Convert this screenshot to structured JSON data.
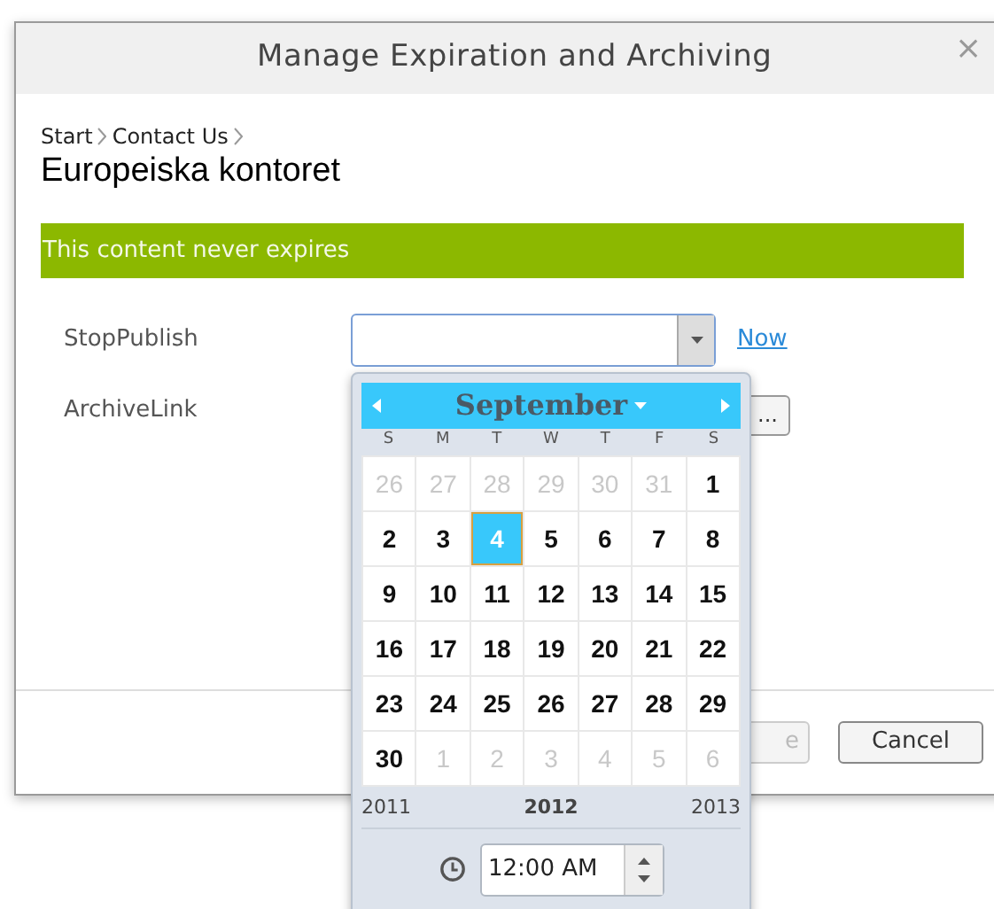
{
  "dialog": {
    "title": "Manage Expiration and Archiving",
    "close": "×"
  },
  "breadcrumb": [
    "Start",
    "Contact Us"
  ],
  "heading": "Europeiska kontoret",
  "notice": "This content never expires",
  "fields": [
    {
      "kind": "date",
      "label": "StopPublish",
      "link": "Now"
    },
    {
      "kind": "browse",
      "label": "ArchiveLink",
      "button": "..."
    }
  ],
  "footer_buttons": [
    {
      "label": "e",
      "covered": true
    },
    {
      "label": "Cancel",
      "covered": false
    }
  ],
  "calendar": {
    "month": "September",
    "prev_year": "2011",
    "year": "2012",
    "next_year": "2013",
    "weekdays": [
      "S",
      "M",
      "T",
      "W",
      "T",
      "F",
      "S"
    ],
    "days": [
      {
        "label": "26",
        "other_month": true,
        "selected": false
      },
      {
        "label": "27",
        "other_month": true,
        "selected": false
      },
      {
        "label": "28",
        "other_month": true,
        "selected": false
      },
      {
        "label": "29",
        "other_month": true,
        "selected": false
      },
      {
        "label": "30",
        "other_month": true,
        "selected": false
      },
      {
        "label": "31",
        "other_month": true,
        "selected": false
      },
      {
        "label": "1",
        "other_month": false,
        "selected": false
      },
      {
        "label": "2",
        "other_month": false,
        "selected": false
      },
      {
        "label": "3",
        "other_month": false,
        "selected": false
      },
      {
        "label": "4",
        "other_month": false,
        "selected": true
      },
      {
        "label": "5",
        "other_month": false,
        "selected": false
      },
      {
        "label": "6",
        "other_month": false,
        "selected": false
      },
      {
        "label": "7",
        "other_month": false,
        "selected": false
      },
      {
        "label": "8",
        "other_month": false,
        "selected": false
      },
      {
        "label": "9",
        "other_month": false,
        "selected": false
      },
      {
        "label": "10",
        "other_month": false,
        "selected": false
      },
      {
        "label": "11",
        "other_month": false,
        "selected": false
      },
      {
        "label": "12",
        "other_month": false,
        "selected": false
      },
      {
        "label": "13",
        "other_month": false,
        "selected": false
      },
      {
        "label": "14",
        "other_month": false,
        "selected": false
      },
      {
        "label": "15",
        "other_month": false,
        "selected": false
      },
      {
        "label": "16",
        "other_month": false,
        "selected": false
      },
      {
        "label": "17",
        "other_month": false,
        "selected": false
      },
      {
        "label": "18",
        "other_month": false,
        "selected": false
      },
      {
        "label": "19",
        "other_month": false,
        "selected": false
      },
      {
        "label": "20",
        "other_month": false,
        "selected": false
      },
      {
        "label": "21",
        "other_month": false,
        "selected": false
      },
      {
        "label": "22",
        "other_month": false,
        "selected": false
      },
      {
        "label": "23",
        "other_month": false,
        "selected": false
      },
      {
        "label": "24",
        "other_month": false,
        "selected": false
      },
      {
        "label": "25",
        "other_month": false,
        "selected": false
      },
      {
        "label": "26",
        "other_month": false,
        "selected": false
      },
      {
        "label": "27",
        "other_month": false,
        "selected": false
      },
      {
        "label": "28",
        "other_month": false,
        "selected": false
      },
      {
        "label": "29",
        "other_month": false,
        "selected": false
      },
      {
        "label": "30",
        "other_month": false,
        "selected": false
      },
      {
        "label": "1",
        "other_month": true,
        "selected": false
      },
      {
        "label": "2",
        "other_month": true,
        "selected": false
      },
      {
        "label": "3",
        "other_month": true,
        "selected": false
      },
      {
        "label": "4",
        "other_month": true,
        "selected": false
      },
      {
        "label": "5",
        "other_month": true,
        "selected": false
      },
      {
        "label": "6",
        "other_month": true,
        "selected": false
      }
    ],
    "time": "12:00 AM"
  }
}
